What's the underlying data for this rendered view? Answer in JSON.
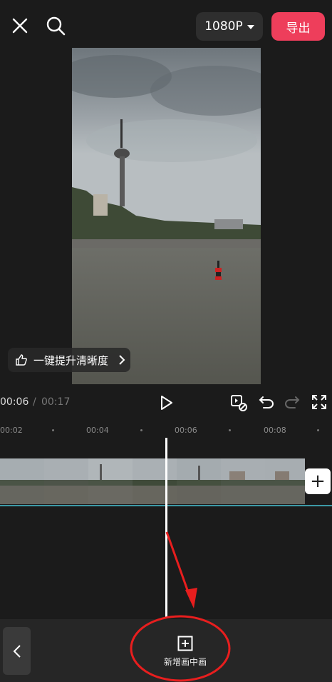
{
  "toolbar": {
    "resolution_label": "1080P",
    "export_label": "导出"
  },
  "preview": {
    "enhance_label": "一键提升清晰度"
  },
  "transport": {
    "current_time": "00:06",
    "separator": "/",
    "total_time": "00:17"
  },
  "timeline": {
    "ticks": [
      "00:02",
      "00:04",
      "00:06",
      "00:08"
    ]
  },
  "bottom_bar": {
    "add_pip_label": "新增画中画"
  },
  "colors": {
    "export": "#ee3e5b",
    "annotation": "#e81e1e",
    "timeline_line": "#3c9aa6"
  },
  "icons": [
    "close-icon",
    "search-icon",
    "caret-down-icon",
    "play-icon",
    "keyframe-icon",
    "undo-icon",
    "redo-icon",
    "fullscreen-icon",
    "thumbs-up-icon",
    "chevron-right-icon",
    "chevron-left-icon",
    "add-icon"
  ]
}
